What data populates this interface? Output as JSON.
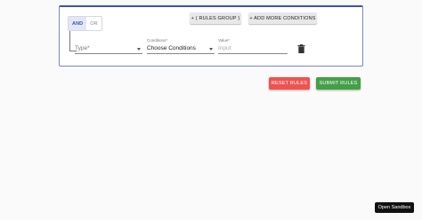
{
  "rule_group": {
    "combinators": [
      "AND",
      "OR"
    ],
    "selected_combinator": "AND",
    "add_group_label": "+ ( RULES GROUP )",
    "add_condition_label": "+ ADD MORE CONDITIONS"
  },
  "rule": {
    "type_field": {
      "label": "",
      "value": "Type*"
    },
    "condition_field": {
      "label": "Conditions*",
      "value": "Choose Conditions"
    },
    "value_field": {
      "label": "Value*",
      "placeholder": "Input"
    }
  },
  "actions": {
    "reset_label": "RESET RULES",
    "submit_label": "SUBMIT RULES"
  },
  "sandbox_label": "Open Sandbox",
  "colors": {
    "accent": "#3f51b5",
    "reset": "#ef5350",
    "submit": "#43a047"
  },
  "icons": {
    "delete": "trash-icon",
    "dropdown": "chevron-down-icon"
  }
}
